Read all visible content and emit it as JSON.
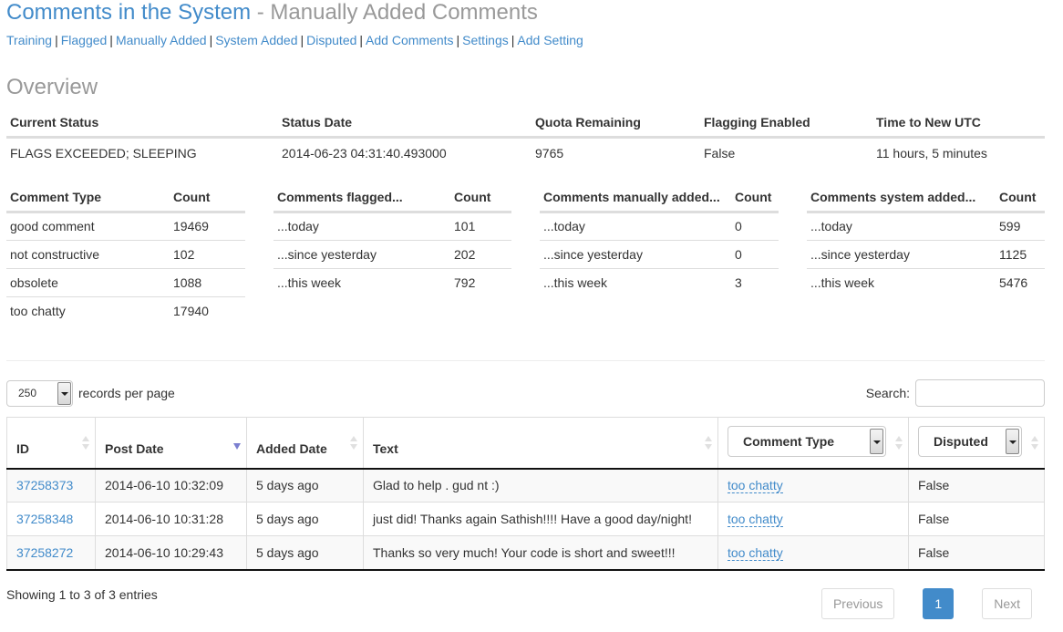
{
  "header": {
    "title": "Comments in the System",
    "separator": " - ",
    "subtitle": "Manually Added Comments"
  },
  "nav": {
    "links": [
      "Training",
      "Flagged",
      "Manually Added",
      "System Added",
      "Disputed",
      "Add Comments",
      "Settings",
      "Add Setting"
    ],
    "separator": "|"
  },
  "overview": {
    "heading": "Overview",
    "status": {
      "headers": [
        "Current Status",
        "Status Date",
        "Quota Remaining",
        "Flagging Enabled",
        "Time to New UTC"
      ],
      "values": [
        "FLAGS EXCEEDED; SLEEPING",
        "2014-06-23 04:31:40.493000",
        "9765",
        "False",
        "11 hours, 5 minutes"
      ]
    },
    "comment_types": {
      "headers": [
        "Comment Type",
        "Count"
      ],
      "rows": [
        [
          "good comment",
          "19469"
        ],
        [
          "not constructive",
          "102"
        ],
        [
          "obsolete",
          "1088"
        ],
        [
          "too chatty",
          "17940"
        ]
      ]
    },
    "flagged": {
      "headers": [
        "Comments flagged...",
        "Count"
      ],
      "rows": [
        [
          "...today",
          "101"
        ],
        [
          "...since yesterday",
          "202"
        ],
        [
          "...this week",
          "792"
        ]
      ]
    },
    "manually_added": {
      "headers": [
        "Comments manually added...",
        "Count"
      ],
      "rows": [
        [
          "...today",
          "0"
        ],
        [
          "...since yesterday",
          "0"
        ],
        [
          "...this week",
          "3"
        ]
      ]
    },
    "system_added": {
      "headers": [
        "Comments system added...",
        "Count"
      ],
      "rows": [
        [
          "...today",
          "599"
        ],
        [
          "...since yesterday",
          "1125"
        ],
        [
          "...this week",
          "5476"
        ]
      ]
    }
  },
  "table_controls": {
    "page_length": "250",
    "page_length_label": "records per page",
    "search_label": "Search:",
    "search_value": ""
  },
  "comments_table": {
    "headers": {
      "id": "ID",
      "post_date": "Post Date",
      "added_date": "Added Date",
      "text": "Text",
      "comment_type": "Comment Type",
      "disputed": "Disputed"
    },
    "sorted_column": "post_date",
    "sort_direction": "desc",
    "rows": [
      {
        "id": "37258373",
        "post_date": "2014-06-10 10:32:09",
        "added_date": "5 days ago",
        "text": "Glad to help . gud nt :)",
        "comment_type": "too chatty",
        "disputed": "False"
      },
      {
        "id": "37258348",
        "post_date": "2014-06-10 10:31:28",
        "added_date": "5 days ago",
        "text": "just did! Thanks again Sathish!!!! Have a good day/night!",
        "comment_type": "too chatty",
        "disputed": "False"
      },
      {
        "id": "37258272",
        "post_date": "2014-06-10 10:29:43",
        "added_date": "5 days ago",
        "text": "Thanks so very much! Your code is short and sweet!!!",
        "comment_type": "too chatty",
        "disputed": "False"
      }
    ]
  },
  "footer": {
    "info": "Showing 1 to 3 of 3 entries",
    "previous": "Previous",
    "current_page": "1",
    "next": "Next"
  },
  "colors": {
    "link": "#428bca",
    "muted": "#999999",
    "sort_active": "#7b7fd0"
  }
}
